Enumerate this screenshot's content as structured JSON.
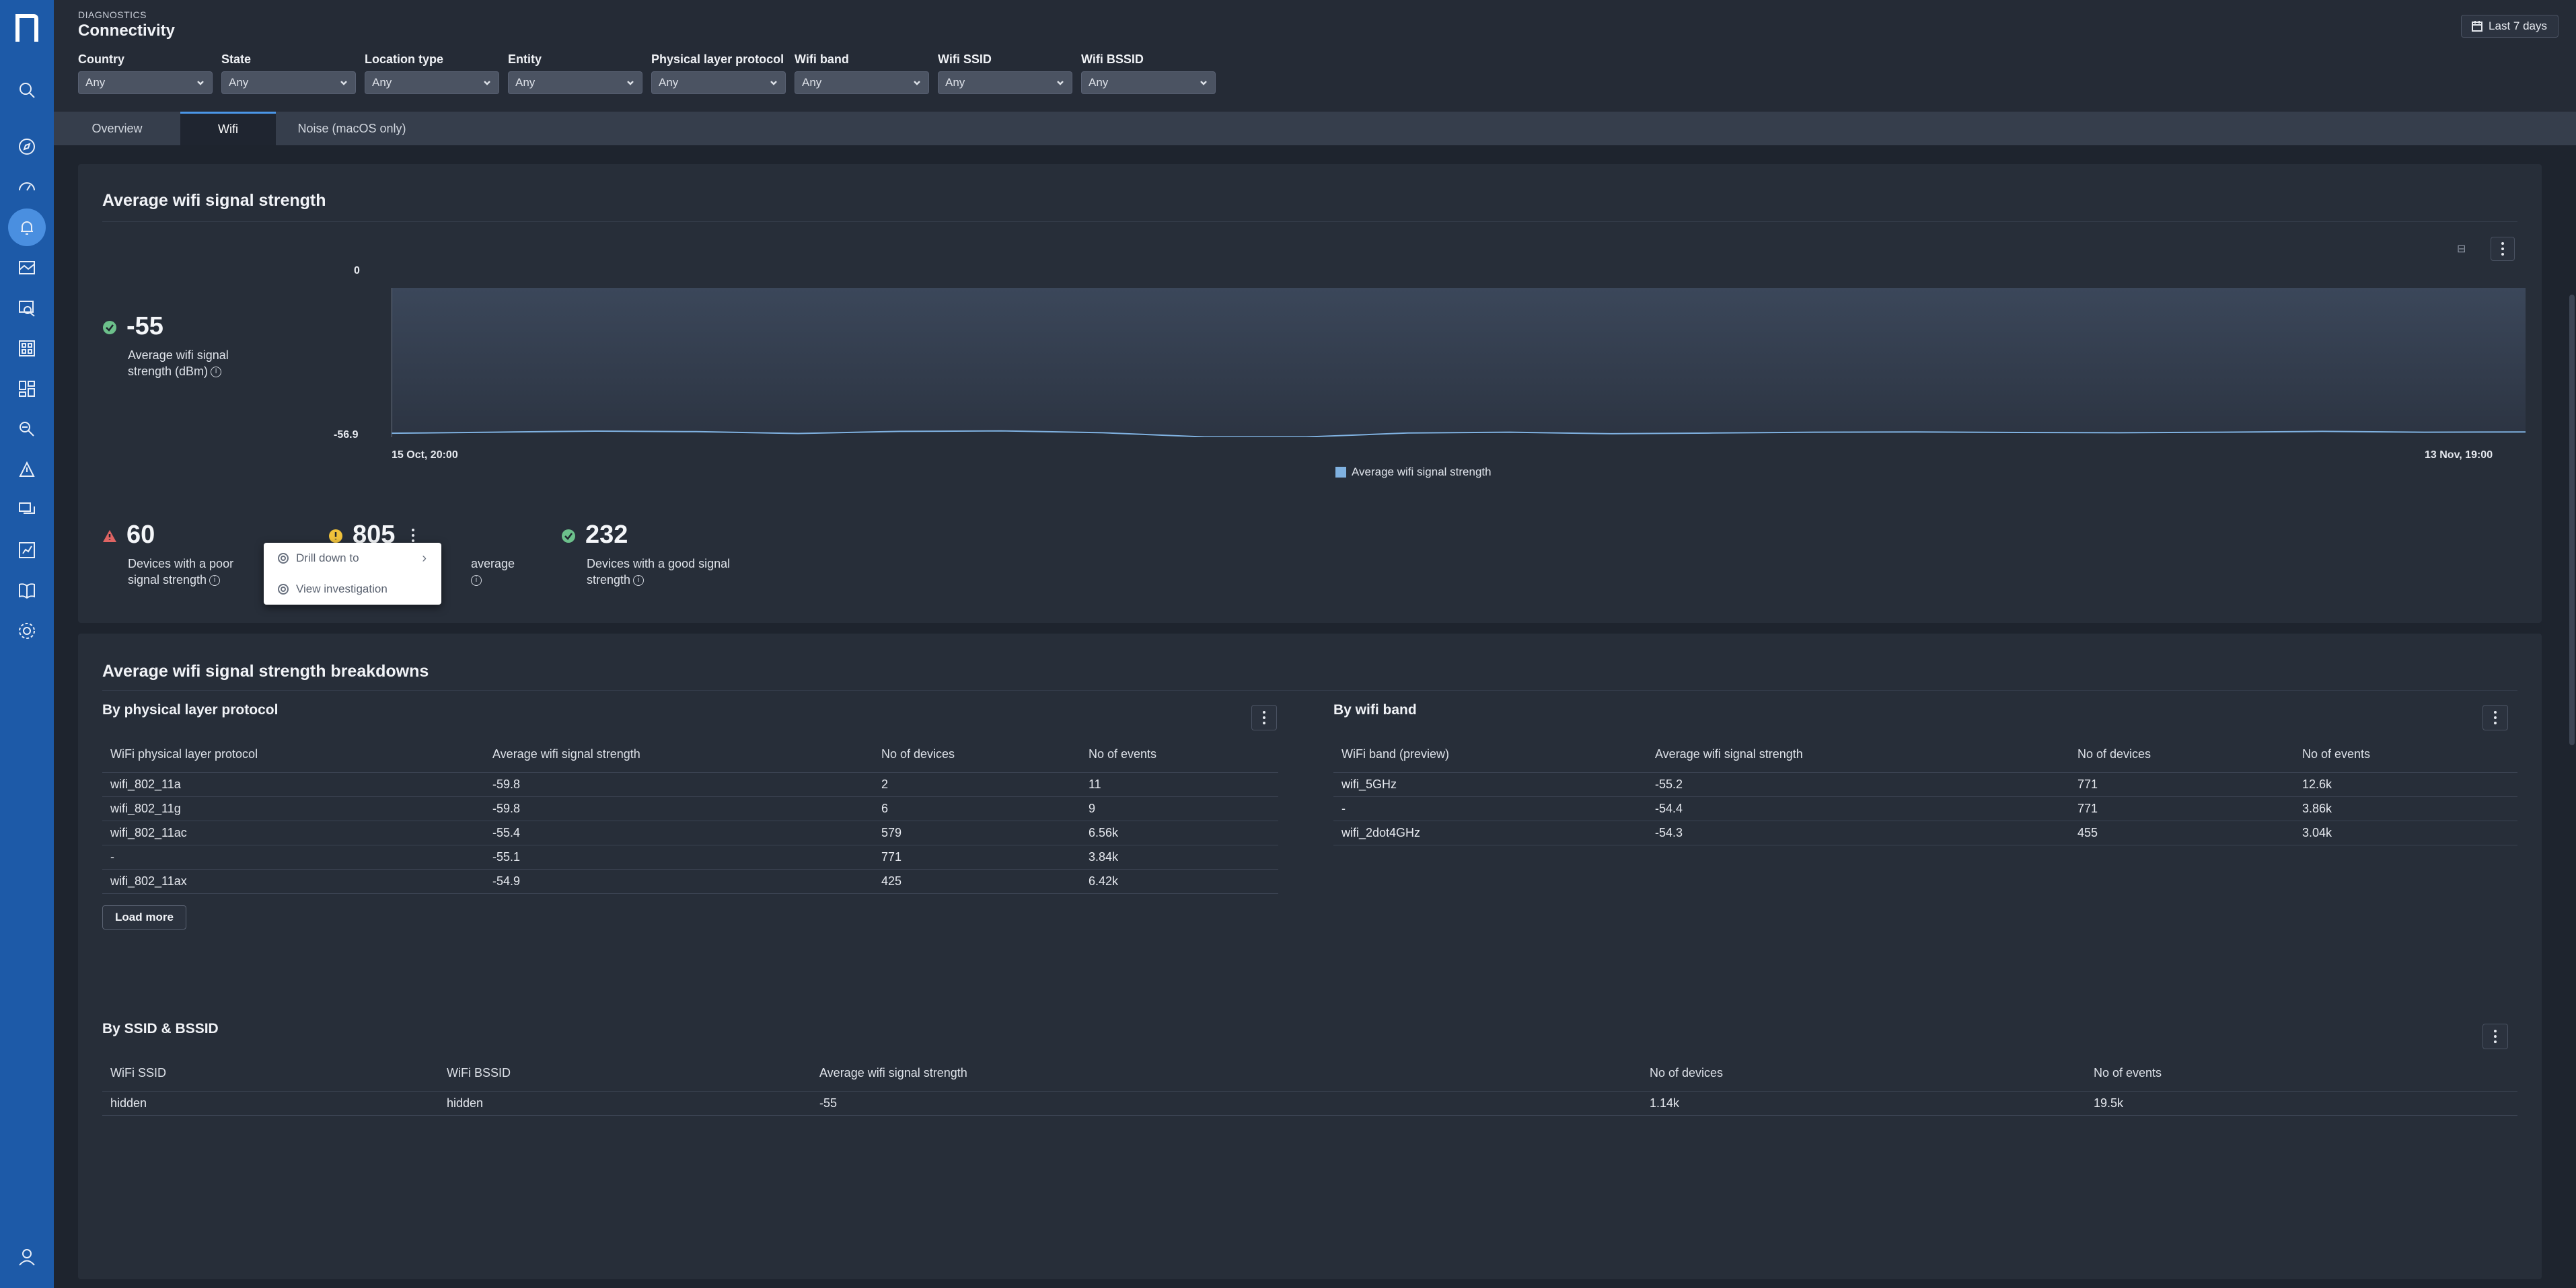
{
  "header": {
    "eyebrow": "DIAGNOSTICS",
    "title": "Connectivity",
    "date_range": "Last 7 days"
  },
  "filters": [
    {
      "label": "Country",
      "value": "Any"
    },
    {
      "label": "State",
      "value": "Any"
    },
    {
      "label": "Location type",
      "value": "Any"
    },
    {
      "label": "Entity",
      "value": "Any"
    },
    {
      "label": "Physical layer protocol",
      "value": "Any"
    },
    {
      "label": "Wifi band",
      "value": "Any"
    },
    {
      "label": "Wifi SSID",
      "value": "Any"
    },
    {
      "label": "Wifi BSSID",
      "value": "Any"
    }
  ],
  "tabs": [
    {
      "label": "Overview",
      "active": false
    },
    {
      "label": "Wifi",
      "active": true
    },
    {
      "label": "Noise (macOS only)",
      "active": false
    }
  ],
  "signal_card": {
    "title": "Average wifi signal strength",
    "kpi_value": "-55",
    "kpi_label_1": "Average wifi signal",
    "kpi_label_2": "strength (dBm)",
    "chart": {
      "y_top": "0",
      "y_bottom": "-56.9",
      "x_start": "15 Oct, 20:00",
      "x_end": "13 Nov, 19:00",
      "legend": "Average wifi signal strength"
    },
    "poor": {
      "value": "60",
      "label_1": "Devices with a poor",
      "label_2": "signal strength"
    },
    "average": {
      "value": "805",
      "label_1": "average",
      "label_2": ""
    },
    "good": {
      "value": "232",
      "label_1": "Devices with a good signal",
      "label_2": "strength"
    }
  },
  "chart_data": {
    "type": "area",
    "x": [
      "15 Oct, 20:00",
      "13 Nov, 19:00"
    ],
    "series": [
      {
        "name": "Average wifi signal strength",
        "values": [
          -55.4,
          -55.0,
          -54.6,
          -54.8,
          -55.5,
          -54.7,
          -54.5,
          -55.2,
          -56.8,
          -56.8,
          -55.3,
          -55.0,
          -55.6,
          -55.3,
          -55.0,
          -54.9,
          -55.1,
          -55.2,
          -55.0,
          -54.7,
          -55.0,
          -54.9
        ]
      }
    ],
    "ylim": [
      -56.9,
      0
    ],
    "xlabel": "",
    "ylabel": ""
  },
  "context_menu": {
    "items": [
      {
        "label": "Drill down to",
        "has_submenu": true
      },
      {
        "label": "View investigation",
        "has_submenu": false
      }
    ]
  },
  "breakdowns": {
    "title": "Average wifi signal strength breakdowns",
    "protocol": {
      "title": "By physical layer protocol",
      "columns": [
        "WiFi physical layer protocol",
        "Average wifi signal strength",
        "No of devices",
        "No of events"
      ],
      "rows": [
        [
          "wifi_802_11a",
          "-59.8",
          "2",
          "11"
        ],
        [
          "wifi_802_11g",
          "-59.8",
          "6",
          "9"
        ],
        [
          "wifi_802_11ac",
          "-55.4",
          "579",
          "6.56k"
        ],
        [
          "-",
          "-55.1",
          "771",
          "3.84k"
        ],
        [
          "wifi_802_11ax",
          "-54.9",
          "425",
          "6.42k"
        ]
      ],
      "load_more": "Load more"
    },
    "band": {
      "title": "By wifi band",
      "columns": [
        "WiFi band (preview)",
        "Average wifi signal strength",
        "No of devices",
        "No of events"
      ],
      "rows": [
        [
          "wifi_5GHz",
          "-55.2",
          "771",
          "12.6k"
        ],
        [
          "-",
          "-54.4",
          "771",
          "3.86k"
        ],
        [
          "wifi_2dot4GHz",
          "-54.3",
          "455",
          "3.04k"
        ]
      ]
    },
    "ssid": {
      "title": "By SSID & BSSID",
      "columns": [
        "WiFi SSID",
        "WiFi BSSID",
        "Average wifi signal strength",
        "No of devices",
        "No of events"
      ],
      "rows": [
        [
          "hidden",
          "hidden",
          "-55",
          "1.14k",
          "19.5k"
        ]
      ]
    }
  }
}
